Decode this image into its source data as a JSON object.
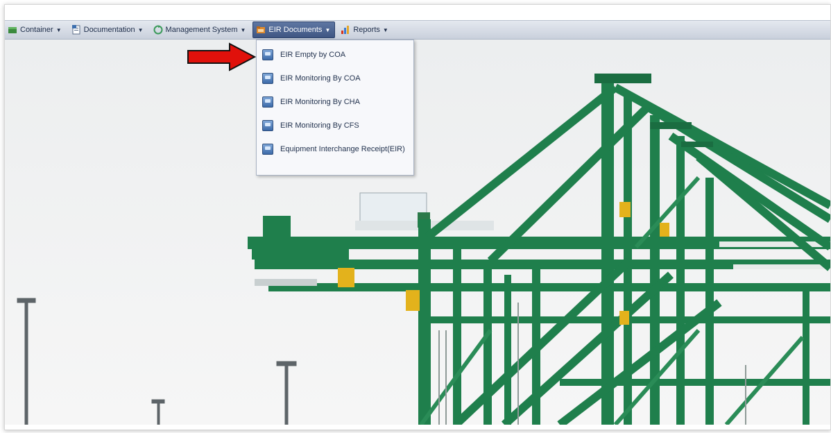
{
  "menubar": {
    "items": [
      {
        "label": "Container",
        "icon": "container-icon",
        "caret": "▼"
      },
      {
        "label": "Documentation",
        "icon": "documentation-icon",
        "caret": "▼"
      },
      {
        "label": "Management System",
        "icon": "management-icon",
        "caret": "▼"
      },
      {
        "label": "EIR Documents",
        "icon": "eir-folder-icon",
        "caret": "▼",
        "active": true
      },
      {
        "label": "Reports",
        "icon": "reports-chart-icon",
        "caret": "▼"
      }
    ]
  },
  "dropdown": {
    "items": [
      {
        "label": "EIR Empty by COA",
        "icon": "monitor-icon"
      },
      {
        "label": "EIR Monitoring By COA",
        "icon": "monitor-icon"
      },
      {
        "label": "EIR Monitoring By CHA",
        "icon": "monitor-icon"
      },
      {
        "label": "EIR Monitoring By CFS",
        "icon": "monitor-icon"
      },
      {
        "label": "Equipment Interchange Receipt(EIR)",
        "icon": "monitor-icon"
      }
    ]
  },
  "annotation": {
    "arrow_color": "#e0110b",
    "points_to": "EIR Empty by COA"
  },
  "colors": {
    "crane_green": "#1f7f4c",
    "menu_active": "#4a6290",
    "sky": "#f2f3f3"
  }
}
